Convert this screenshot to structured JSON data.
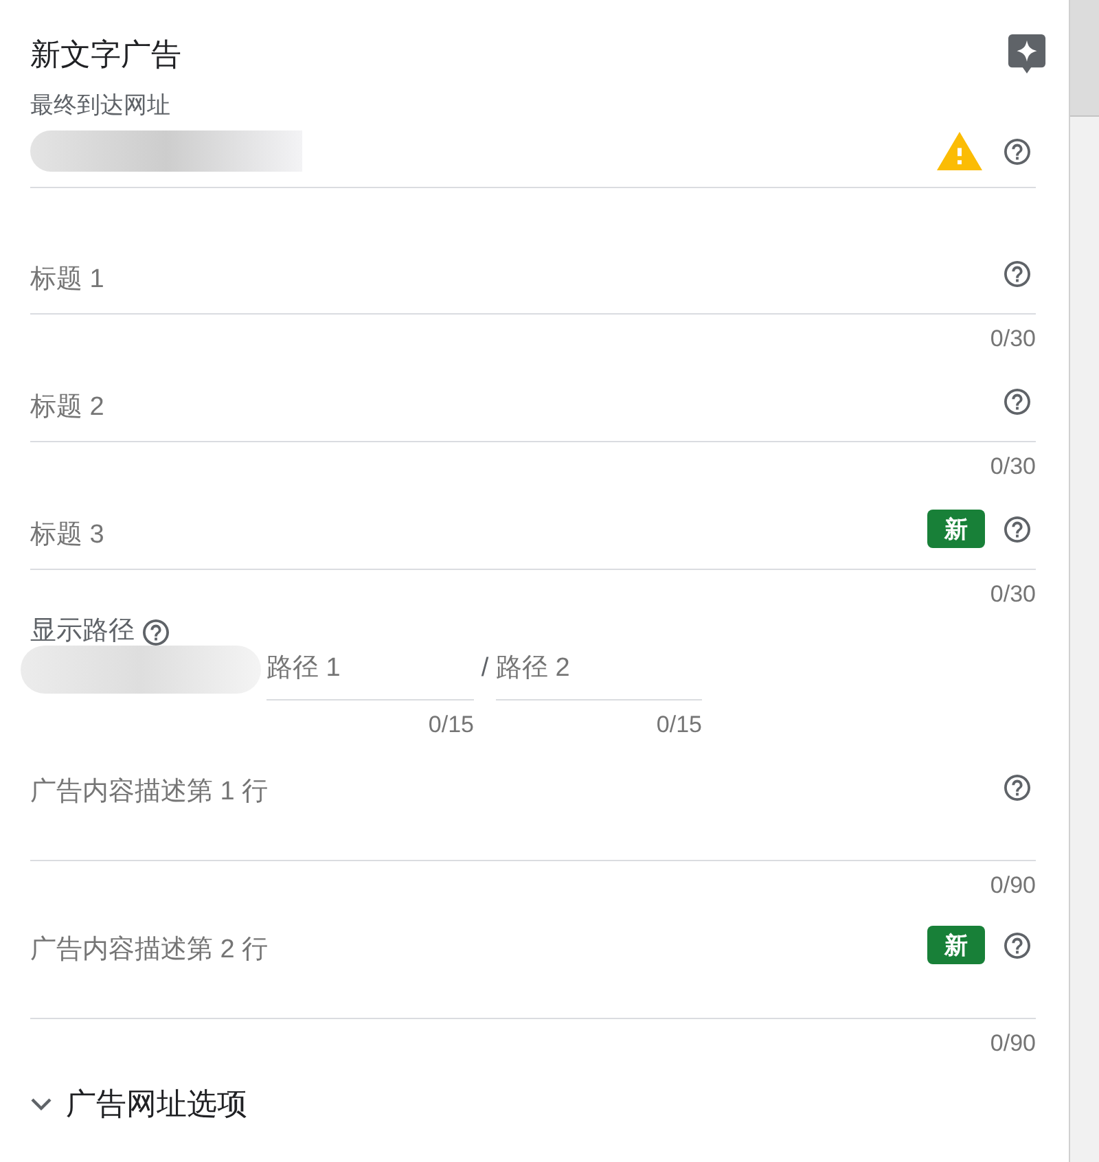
{
  "panel": {
    "title": "新文字广告"
  },
  "final_url": {
    "label": "最终到达网址",
    "warning": true
  },
  "headlines": [
    {
      "placeholder": "标题 1",
      "counter": "0/30"
    },
    {
      "placeholder": "标题 2",
      "counter": "0/30"
    },
    {
      "placeholder": "标题 3",
      "counter": "0/30",
      "badge": "新"
    }
  ],
  "display_path": {
    "label": "显示路径",
    "separator": "/",
    "paths": [
      {
        "placeholder": "路径 1",
        "counter": "0/15"
      },
      {
        "placeholder": "路径 2",
        "counter": "0/15"
      }
    ]
  },
  "descriptions": [
    {
      "placeholder": "广告内容描述第 1 行",
      "counter": "0/90"
    },
    {
      "placeholder": "广告内容描述第 2 行",
      "counter": "0/90",
      "badge": "新"
    }
  ],
  "url_options": {
    "label": "广告网址选项",
    "expanded": false
  }
}
